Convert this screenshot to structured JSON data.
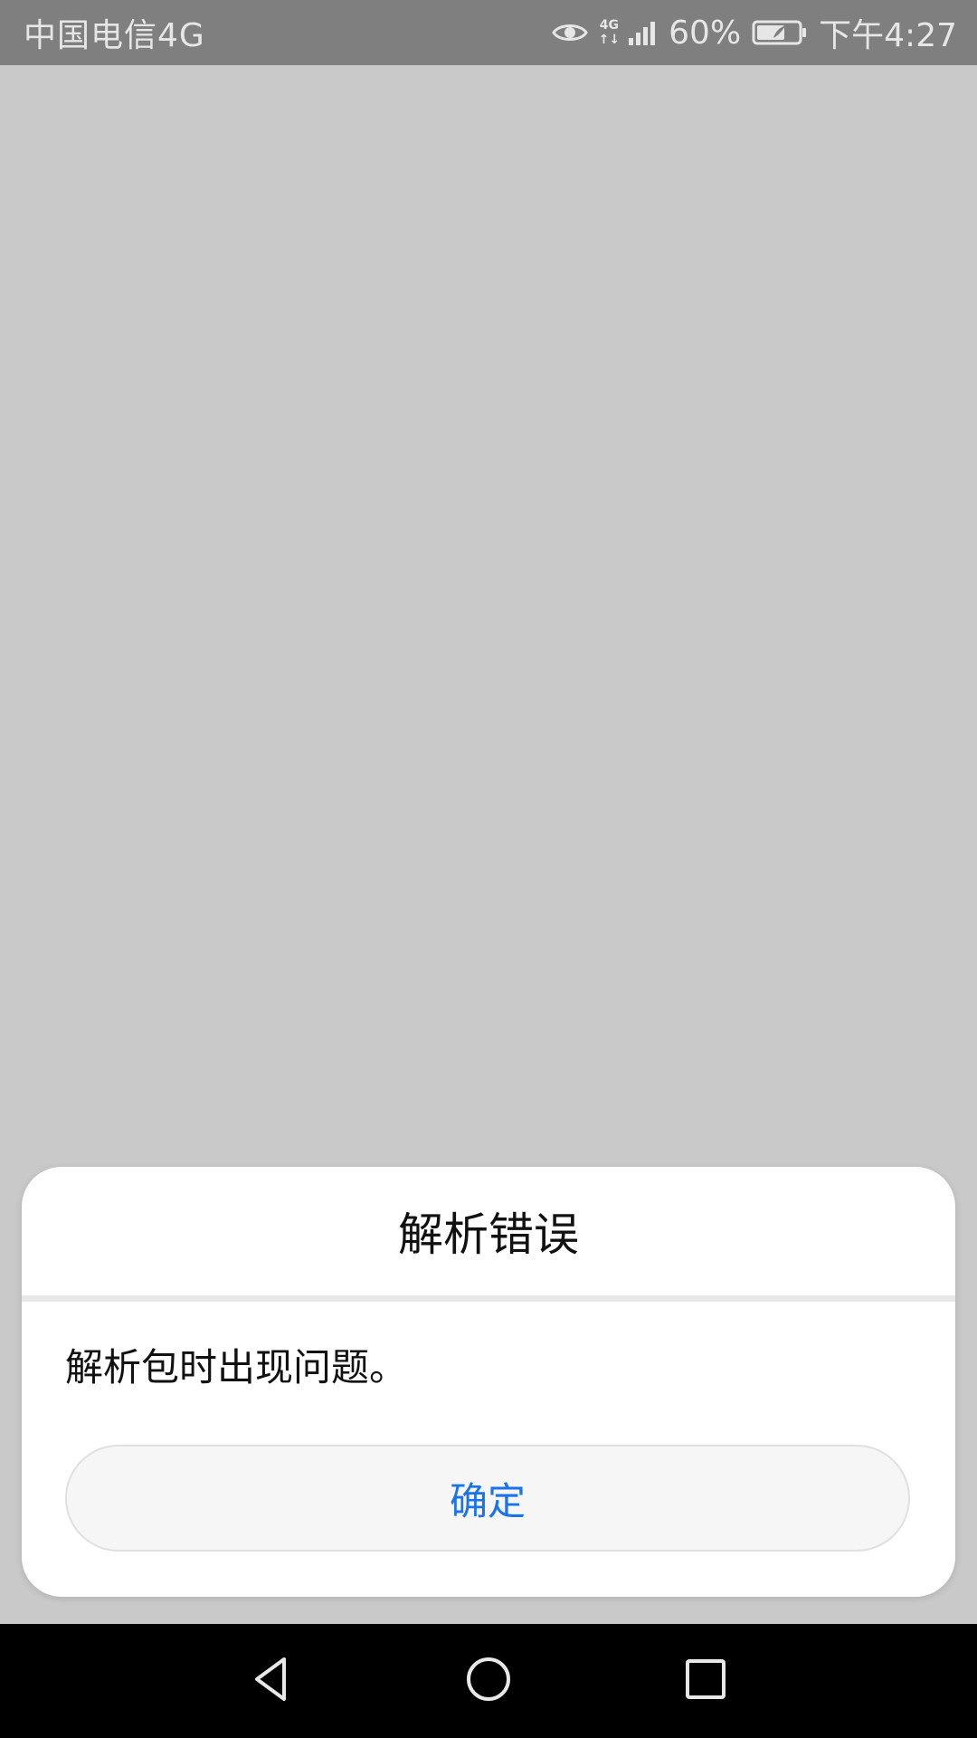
{
  "status_bar": {
    "carrier": "中国电信4G",
    "network_type_top": "4G",
    "network_type_bottom": "↑↓",
    "battery_percent": "60%",
    "time": "下午4:27",
    "icons": [
      "eye-icon",
      "signal-icon",
      "battery-icon"
    ]
  },
  "dialog": {
    "title": "解析错误",
    "message": "解析包时出现问题。",
    "ok_label": "确定",
    "accent_color": "#1a73e8"
  },
  "nav_bar": {
    "icons": [
      "back-icon",
      "home-icon",
      "recents-icon"
    ]
  }
}
